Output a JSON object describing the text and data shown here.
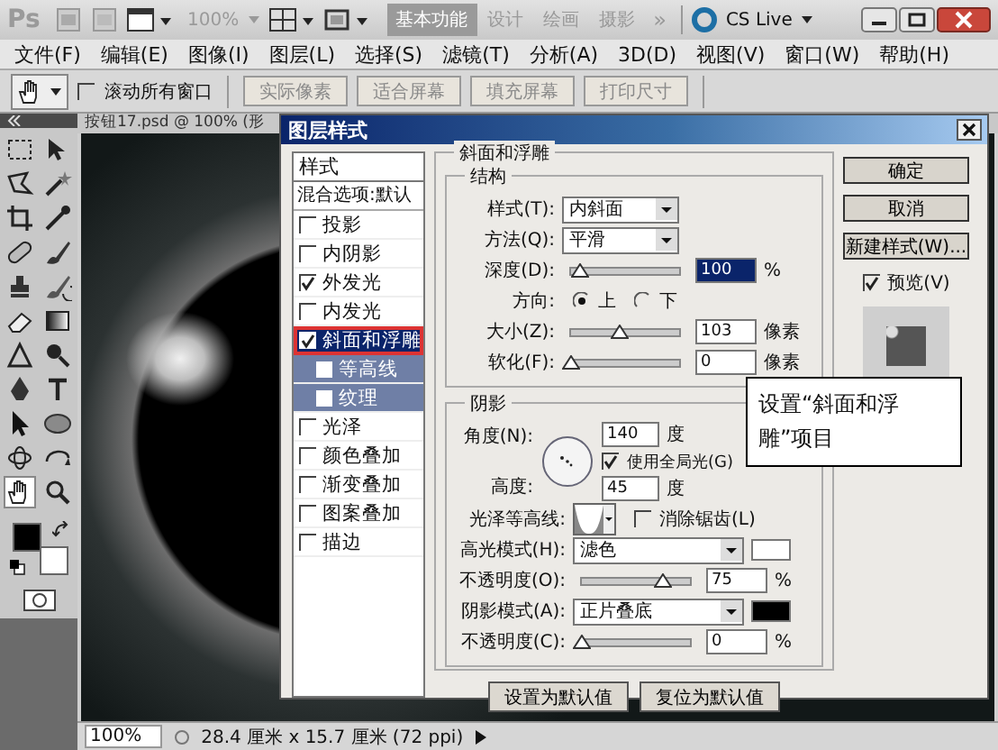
{
  "app_bar": {
    "logo": "Ps",
    "zoom": "100%",
    "workspaces": [
      {
        "label": "基本功能",
        "selected": true
      },
      {
        "label": "设计",
        "selected": false
      },
      {
        "label": "绘画",
        "selected": false
      },
      {
        "label": "摄影",
        "selected": false
      }
    ],
    "more": "»",
    "cs_live": "CS Live"
  },
  "menu": [
    "文件(F)",
    "编辑(E)",
    "图像(I)",
    "图层(L)",
    "选择(S)",
    "滤镜(T)",
    "分析(A)",
    "3D(D)",
    "视图(V)",
    "窗口(W)",
    "帮助(H)"
  ],
  "options_bar": {
    "scroll_all": {
      "label": "滚动所有窗口",
      "checked": false
    },
    "buttons": [
      {
        "label": "实际像素",
        "disabled": true
      },
      {
        "label": "适合屏幕",
        "disabled": true
      },
      {
        "label": "填充屏幕",
        "disabled": true
      },
      {
        "label": "打印尺寸",
        "disabled": true
      }
    ]
  },
  "document": {
    "tab": "按钮17.psd @ 100% (形",
    "status_zoom": "100%",
    "status_info": "28.4 厘米 x 15.7 厘米 (72 ppi)"
  },
  "dialog": {
    "title": "图层样式",
    "styles_header": "样式",
    "blending": "混合选项:默认",
    "effects": [
      {
        "label": "投影",
        "checked": false,
        "selected": false
      },
      {
        "label": "内阴影",
        "checked": false,
        "selected": false
      },
      {
        "label": "外发光",
        "checked": true,
        "selected": false
      },
      {
        "label": "内发光",
        "checked": false,
        "selected": false
      },
      {
        "label": "斜面和浮雕",
        "checked": true,
        "selected": true,
        "children": [
          {
            "label": "等高线",
            "checked": false,
            "selected": false
          },
          {
            "label": "纹理",
            "checked": false,
            "selected": false
          }
        ]
      },
      {
        "label": "光泽",
        "checked": false,
        "selected": false
      },
      {
        "label": "颜色叠加",
        "checked": false,
        "selected": false
      },
      {
        "label": "渐变叠加",
        "checked": false,
        "selected": false
      },
      {
        "label": "图案叠加",
        "checked": false,
        "selected": false
      },
      {
        "label": "描边",
        "checked": false,
        "selected": false
      }
    ],
    "panel": {
      "title": "斜面和浮雕",
      "structure": {
        "title": "结构",
        "style": {
          "label": "样式(T):",
          "value": "内斜面"
        },
        "technique": {
          "label": "方法(Q):",
          "value": "平滑"
        },
        "depth": {
          "label": "深度(D):",
          "level": 0.08,
          "value": "100",
          "unit": "%",
          "focused": true
        },
        "direction": {
          "label": "方向:",
          "options": [
            {
              "label": "上",
              "selected": true
            },
            {
              "label": "下",
              "selected": false
            }
          ]
        },
        "size": {
          "label": "大小(Z):",
          "level": 0.45,
          "value": "103",
          "unit": "像素",
          "focused": false
        },
        "soften": {
          "label": "软化(F):",
          "level": 0,
          "value": "0",
          "unit": "像素",
          "focused": false
        }
      },
      "shading": {
        "title": "阴影",
        "angle": {
          "label": "角度(N):",
          "value": "140",
          "unit": "度"
        },
        "global_light": {
          "label": "使用全局光(G)",
          "checked": true
        },
        "altitude": {
          "label": "高度:",
          "value": "45",
          "unit": "度"
        },
        "gloss_contour": {
          "label": "光泽等高线:"
        },
        "anti_aliased": {
          "label": "消除锯齿(L)",
          "checked": false
        },
        "highlight_mode": {
          "label": "高光模式(H):",
          "value": "滤色",
          "color": "#ffffff"
        },
        "highlight_opacity": {
          "label": "不透明度(O):",
          "level": 0.75,
          "value": "75",
          "unit": "%",
          "focused": false
        },
        "shadow_mode": {
          "label": "阴影模式(A):",
          "value": "正片叠底",
          "color": "#000000"
        },
        "shadow_opacity": {
          "label": "不透明度(C):",
          "level": 0,
          "value": "0",
          "unit": "%",
          "focused": false
        }
      },
      "buttons": [
        "设置为默认值",
        "复位为默认值"
      ]
    },
    "actions": [
      "确定",
      "取消",
      "新建样式(W)..."
    ],
    "preview": {
      "label": "预览(V)",
      "checked": true
    }
  },
  "callout": "设置“斜面和浮雕”项目"
}
